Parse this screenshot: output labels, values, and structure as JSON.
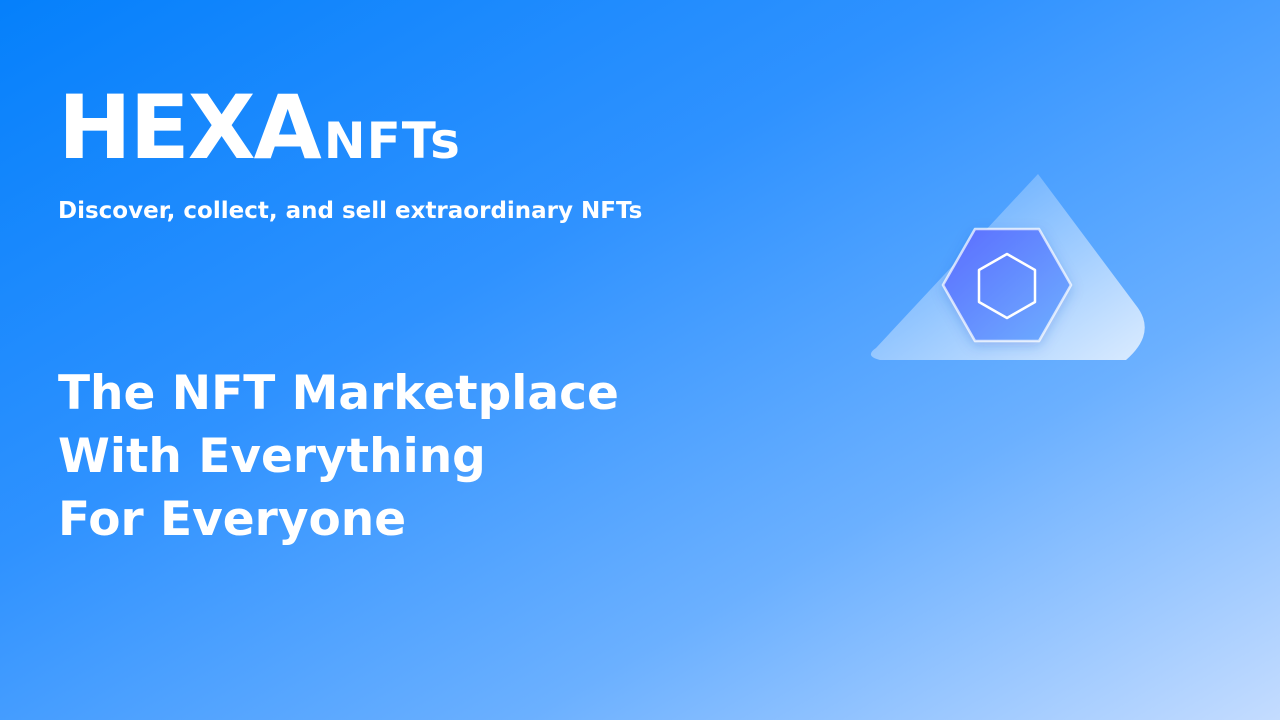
{
  "brand": {
    "main": "HEXA",
    "sub": "NFTs"
  },
  "tagline": "Discover, collect, and sell extraordinary NFTs",
  "headline": {
    "line1": "The NFT Marketplace",
    "line2": "With Everything",
    "line3": "For Everyone"
  },
  "graphic": {
    "icon": "hexagon-logo-icon",
    "colors": {
      "hex_fill_start": "#5a78ff",
      "hex_fill_end": "#6aa8ff",
      "accent": "#ffffff"
    }
  },
  "colors": {
    "bg_start": "#0580fb",
    "bg_end": "#c4dcff",
    "text": "#ffffff"
  }
}
